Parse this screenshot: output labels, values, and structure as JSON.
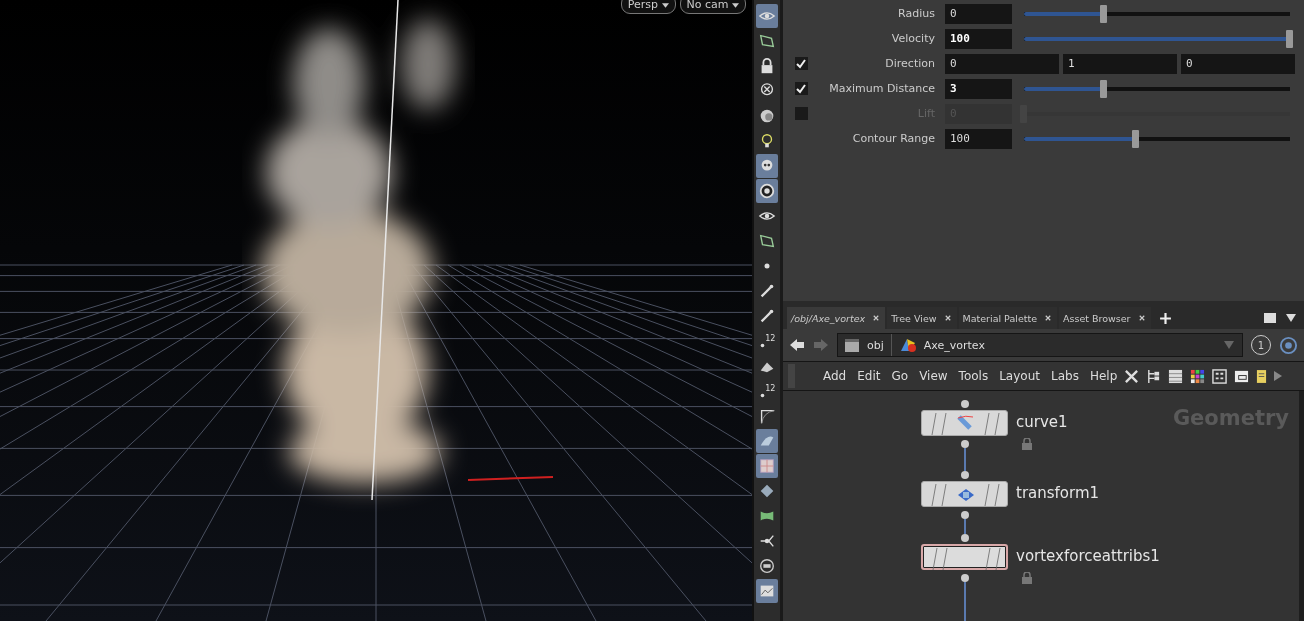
{
  "viewport": {
    "view_menu": "Persp",
    "camera_menu": "No cam"
  },
  "tools": [
    {
      "kind": "eye",
      "selected": true
    },
    {
      "kind": "select",
      "selected": false
    },
    {
      "kind": "lock",
      "selected": false
    },
    {
      "kind": "bulb-off",
      "selected": false
    },
    {
      "kind": "sphere",
      "selected": false
    },
    {
      "kind": "bulb",
      "selected": false
    },
    {
      "kind": "skull",
      "selected": true
    },
    {
      "kind": "camera",
      "selected": true
    },
    {
      "kind": "eye",
      "selected": false
    },
    {
      "kind": "select",
      "selected": false
    },
    {
      "kind": "dot",
      "selected": false
    },
    {
      "kind": "pen",
      "selected": false
    },
    {
      "kind": "pen",
      "selected": false
    },
    {
      "kind": "count",
      "label": "12",
      "selected": false
    },
    {
      "kind": "brush",
      "selected": false
    },
    {
      "kind": "count",
      "label": "12",
      "selected": false
    },
    {
      "kind": "corner",
      "selected": false
    },
    {
      "kind": "wing",
      "selected": true
    },
    {
      "kind": "grid",
      "selected": true
    },
    {
      "kind": "diamond",
      "selected": false
    },
    {
      "kind": "leaf",
      "selected": false
    },
    {
      "kind": "node",
      "selected": false
    },
    {
      "kind": "ring",
      "selected": false
    },
    {
      "kind": "picture",
      "selected": true
    }
  ],
  "parameters": [
    {
      "kind": "slider",
      "label": "Radius",
      "value": "0",
      "modified": false,
      "level": 0.3
    },
    {
      "kind": "slider",
      "label": "Velocity",
      "value": "100",
      "modified": true,
      "level": 1.0
    },
    {
      "kind": "vector",
      "label": "Direction",
      "checked": true,
      "values": [
        "0",
        "1",
        "0"
      ]
    },
    {
      "kind": "slider",
      "label": "Maximum Distance",
      "checked": true,
      "value": "3",
      "modified": true,
      "level": 0.3,
      "disabled": false
    },
    {
      "kind": "slider",
      "label": "Lift",
      "checked": false,
      "value": "0",
      "modified": false,
      "level": 0,
      "disabled": true
    },
    {
      "kind": "slider",
      "label": "Contour Range",
      "value": "100",
      "modified": false,
      "level": 0.42
    }
  ],
  "network": {
    "tabs": [
      {
        "label": "/obj/Axe_vortex",
        "selected": true
      },
      {
        "label": "Tree View",
        "selected": false
      },
      {
        "label": "Material Palette",
        "selected": false
      },
      {
        "label": "Asset Browser",
        "selected": false
      }
    ],
    "path": [
      "obj",
      "Axe_vortex"
    ],
    "counter": "1",
    "menu": [
      "Add",
      "Edit",
      "Go",
      "View",
      "Tools",
      "Layout",
      "Labs",
      "Help"
    ],
    "context_label": "Geometry",
    "nodes": [
      {
        "name": "curve1",
        "kind": "curve",
        "selected": false,
        "locked": true
      },
      {
        "name": "transform1",
        "kind": "transform",
        "selected": false,
        "locked": false
      },
      {
        "name": "vortexforceattribs1",
        "kind": "plain",
        "selected": true,
        "locked": true
      }
    ]
  }
}
